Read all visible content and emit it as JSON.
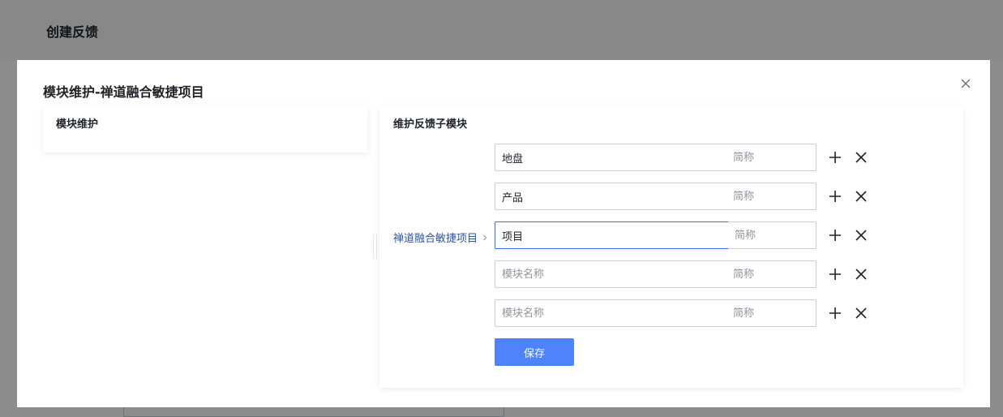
{
  "background": {
    "title": "创建反馈"
  },
  "modal": {
    "title": "模块维护-禅道融合敏捷项目"
  },
  "left_panel": {
    "title": "模块维护"
  },
  "right_panel": {
    "title": "维护反馈子模块",
    "breadcrumb": "禅道融合敏捷项目",
    "rows": [
      {
        "name_value": "地盘",
        "name_placeholder": "模块名称",
        "abbr_value": "",
        "abbr_placeholder": "简称"
      },
      {
        "name_value": "产品",
        "name_placeholder": "模块名称",
        "abbr_value": "",
        "abbr_placeholder": "简称"
      },
      {
        "name_value": "项目",
        "name_placeholder": "模块名称",
        "abbr_value": "",
        "abbr_placeholder": "简称"
      },
      {
        "name_value": "",
        "name_placeholder": "模块名称",
        "abbr_value": "",
        "abbr_placeholder": "简称"
      },
      {
        "name_value": "",
        "name_placeholder": "模块名称",
        "abbr_value": "",
        "abbr_placeholder": "简称"
      }
    ],
    "save_label": "保存"
  },
  "icons": {
    "close": "close-icon",
    "add": "plus-icon",
    "delete": "x-icon",
    "breadcrumb_chevron": "chevron-right-icon"
  },
  "colors": {
    "primary": "#4e83fd",
    "focus_border": "#3370ff",
    "breadcrumb": "#2a55a3"
  }
}
